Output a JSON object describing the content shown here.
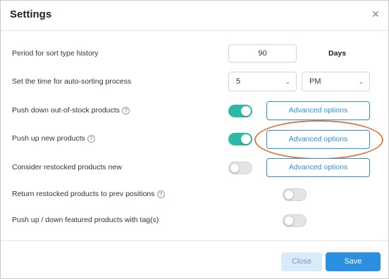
{
  "dialog": {
    "title": "Settings",
    "close_icon": "close-icon"
  },
  "rows": {
    "period": {
      "label": "Period for sort type history",
      "value": "90",
      "unit": "Days"
    },
    "auto_sort": {
      "label": "Set the time for auto-sorting process",
      "hour": "5",
      "ampm": "PM"
    },
    "push_down": {
      "label": "Push down out-of-stock products",
      "toggle": true,
      "button": "Advanced options"
    },
    "push_up": {
      "label": "Push up new products",
      "toggle": true,
      "button": "Advanced options"
    },
    "restocked_new": {
      "label": "Consider restocked products new",
      "toggle": false,
      "button": "Advanced options"
    },
    "return_restocked": {
      "label": "Return restocked products to prev positions",
      "toggle": false
    },
    "featured_tag": {
      "label": "Push up / down featured products with tag(s)",
      "toggle": false
    }
  },
  "footer": {
    "close_label": "Close",
    "save_label": "Save"
  },
  "colors": {
    "accent": "#2d8fe0",
    "toggle_on": "#2bbaa5",
    "highlight": "#e07a3a"
  },
  "icons": {
    "help": "question-circle-icon",
    "chevron": "chevron-down-icon"
  }
}
